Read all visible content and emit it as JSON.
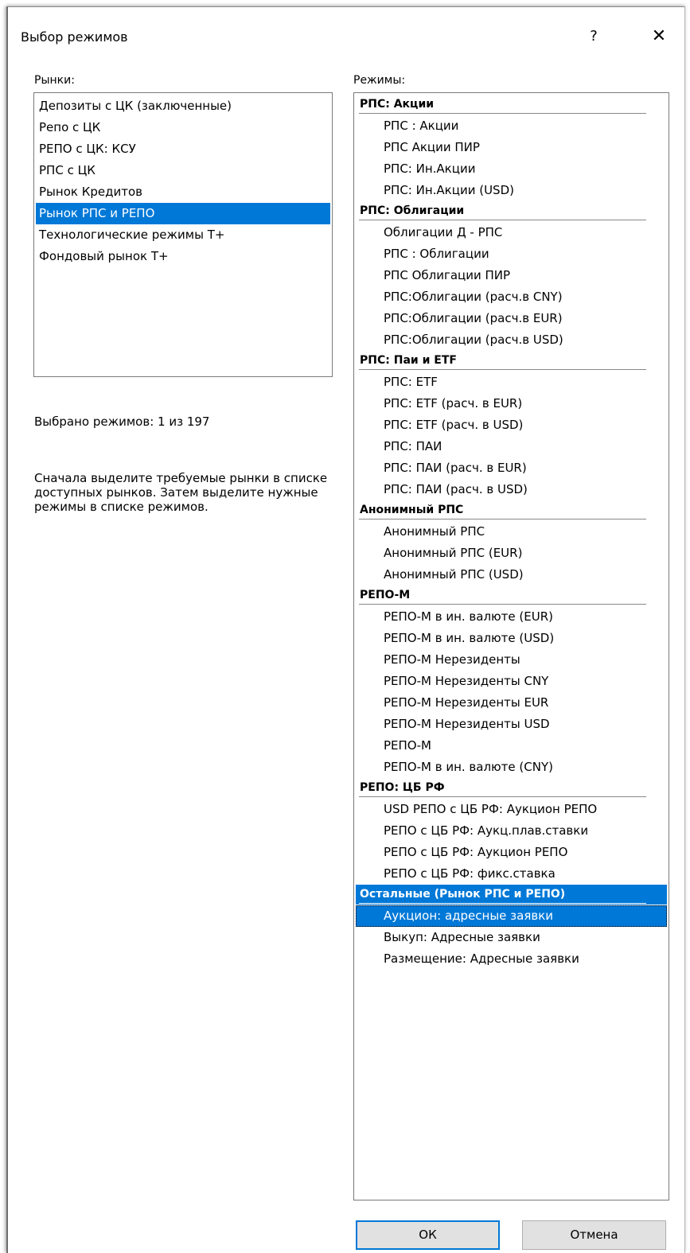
{
  "window": {
    "title": "Выбор режимов",
    "help_label": "?",
    "close_label": "✕"
  },
  "markets": {
    "label": "Рынки:",
    "items": [
      {
        "label": "Депозиты с ЦК (заключенные)",
        "selected": false
      },
      {
        "label": "Репо с ЦК",
        "selected": false
      },
      {
        "label": "РЕПО с ЦК: КСУ",
        "selected": false
      },
      {
        "label": "РПС с ЦК",
        "selected": false
      },
      {
        "label": "Рынок Кредитов",
        "selected": false
      },
      {
        "label": "Рынок РПС и РЕПО",
        "selected": true
      },
      {
        "label": "Технологические режимы Т+",
        "selected": false
      },
      {
        "label": "Фондовый рынок Т+",
        "selected": false
      }
    ]
  },
  "status": {
    "selected_text": "Выбрано режимов: 1 из 197",
    "hint": "Сначала выделите требуемые рынки в списке доступных рынков. Затем выделите нужные режимы в списке режимов."
  },
  "modes": {
    "label": "Режимы:",
    "groups": [
      {
        "title": "РПС: Акции",
        "selected": false,
        "items": [
          {
            "label": "РПС : Акции",
            "selected": false
          },
          {
            "label": "РПС Акции ПИР",
            "selected": false
          },
          {
            "label": "РПС: Ин.Акции",
            "selected": false
          },
          {
            "label": "РПС: Ин.Акции (USD)",
            "selected": false
          }
        ]
      },
      {
        "title": "РПС: Облигации",
        "selected": false,
        "items": [
          {
            "label": "Облигации Д - РПС",
            "selected": false
          },
          {
            "label": "РПС : Облигации",
            "selected": false
          },
          {
            "label": "РПС Облигации ПИР",
            "selected": false
          },
          {
            "label": "РПС:Облигации (расч.в CNY)",
            "selected": false
          },
          {
            "label": "РПС:Облигации (расч.в EUR)",
            "selected": false
          },
          {
            "label": "РПС:Облигации (расч.в USD)",
            "selected": false
          }
        ]
      },
      {
        "title": "РПС: Паи и ETF",
        "selected": false,
        "items": [
          {
            "label": "РПС: ETF",
            "selected": false
          },
          {
            "label": "РПС: ETF (расч. в EUR)",
            "selected": false
          },
          {
            "label": "РПС: ETF (расч. в USD)",
            "selected": false
          },
          {
            "label": "РПС: ПАИ",
            "selected": false
          },
          {
            "label": "РПС: ПАИ (расч. в EUR)",
            "selected": false
          },
          {
            "label": "РПС: ПАИ (расч. в USD)",
            "selected": false
          }
        ]
      },
      {
        "title": "Анонимный РПС",
        "selected": false,
        "items": [
          {
            "label": "Анонимный РПС",
            "selected": false
          },
          {
            "label": "Анонимный РПС (EUR)",
            "selected": false
          },
          {
            "label": "Анонимный РПС (USD)",
            "selected": false
          }
        ]
      },
      {
        "title": "РЕПО-М",
        "selected": false,
        "items": [
          {
            "label": "РЕПО-М в ин. валюте (EUR)",
            "selected": false
          },
          {
            "label": "РЕПО-М в ин. валюте (USD)",
            "selected": false
          },
          {
            "label": "РЕПО-М Нерезиденты",
            "selected": false
          },
          {
            "label": "РЕПО-М Нерезиденты CNY",
            "selected": false
          },
          {
            "label": "РЕПО-М Нерезиденты EUR",
            "selected": false
          },
          {
            "label": "РЕПО-М Нерезиденты USD",
            "selected": false
          },
          {
            "label": "РЕПО-М",
            "selected": false
          },
          {
            "label": "РЕПО-М в ин. валюте (CNY)",
            "selected": false
          }
        ]
      },
      {
        "title": "РЕПО: ЦБ РФ",
        "selected": false,
        "items": [
          {
            "label": "USD РЕПО с ЦБ РФ: Аукцион РЕПО",
            "selected": false
          },
          {
            "label": "РЕПО с ЦБ РФ: Аукц.плав.ставки",
            "selected": false
          },
          {
            "label": "РЕПО с ЦБ РФ: Аукцион РЕПО",
            "selected": false
          },
          {
            "label": "РЕПО с ЦБ РФ: фикс.ставка",
            "selected": false
          }
        ]
      },
      {
        "title": "Остальные (Рынок РПС и РЕПО)",
        "selected": true,
        "items": [
          {
            "label": "Аукцион: адресные заявки",
            "selected": true
          },
          {
            "label": "Выкуп: Адресные заявки",
            "selected": false
          },
          {
            "label": "Размещение: Адресные заявки",
            "selected": false
          }
        ]
      }
    ]
  },
  "buttons": {
    "ok_label": "ОК",
    "cancel_label": "Отмена"
  },
  "colors": {
    "selection": "#0078d7",
    "button_face": "#e1e1e1",
    "default_button_border": "#0078d7"
  }
}
